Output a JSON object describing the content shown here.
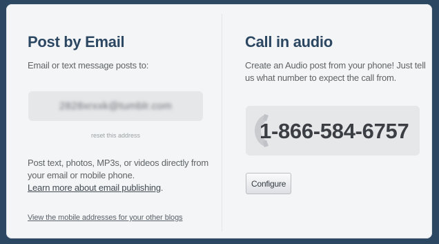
{
  "post_by_email": {
    "title": "Post by Email",
    "subtitle": "Email or text message posts to:",
    "email_address": "2828xrxxk@tumblr.com",
    "reset_link": "reset this address",
    "body_text": "Post text, photos, MP3s, or videos directly from your email or mobile phone.",
    "learn_more_link": "Learn more about email publishing",
    "learn_more_suffix": ".",
    "mobile_addresses_link": "View the mobile addresses for your other blogs"
  },
  "call_in_audio": {
    "title": "Call in audio",
    "description": "Create an Audio post from your phone! Just tell us what number to expect the call from.",
    "phone_number": "1-866-584-6757",
    "configure_label": "Configure"
  },
  "colors": {
    "background": "#2c4762",
    "panel": "#f4f5f7",
    "heading": "#2c4762",
    "field": "#e6e7e9"
  },
  "icons": {
    "phone": "phone-handset-icon"
  }
}
